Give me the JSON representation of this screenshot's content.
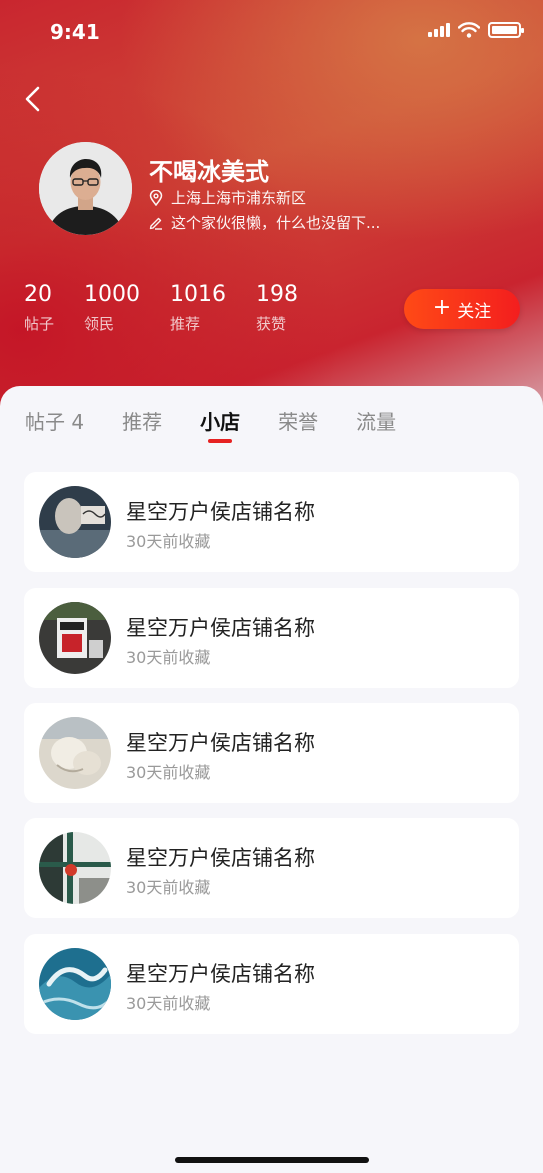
{
  "status": {
    "time": "9:41"
  },
  "profile": {
    "name": "不喝冰美式",
    "location": "上海上海市浦东新区",
    "bio": "这个家伙很懒，什么也没留下...",
    "follow_label": "关注"
  },
  "stats": [
    {
      "value": "20",
      "label": "帖子"
    },
    {
      "value": "1000",
      "label": "领民"
    },
    {
      "value": "1016",
      "label": "推荐"
    },
    {
      "value": "198",
      "label": "获赞"
    }
  ],
  "tabs": [
    {
      "label": "帖子 4",
      "active": false
    },
    {
      "label": "推荐",
      "active": false
    },
    {
      "label": "小店",
      "active": true
    },
    {
      "label": "荣誉",
      "active": false
    },
    {
      "label": "流量",
      "active": false
    }
  ],
  "shops": [
    {
      "name": "星空万户侯店铺名称",
      "sub": "30天前收藏"
    },
    {
      "name": "星空万户侯店铺名称",
      "sub": "30天前收藏"
    },
    {
      "name": "星空万户侯店铺名称",
      "sub": "30天前收藏"
    },
    {
      "name": "星空万户侯店铺名称",
      "sub": "30天前收藏"
    },
    {
      "name": "星空万户侯店铺名称",
      "sub": "30天前收藏"
    }
  ],
  "colors": {
    "accent": "#e62222",
    "follow_gradient_start": "#ff4a16",
    "follow_gradient_end": "#f31e1e"
  }
}
